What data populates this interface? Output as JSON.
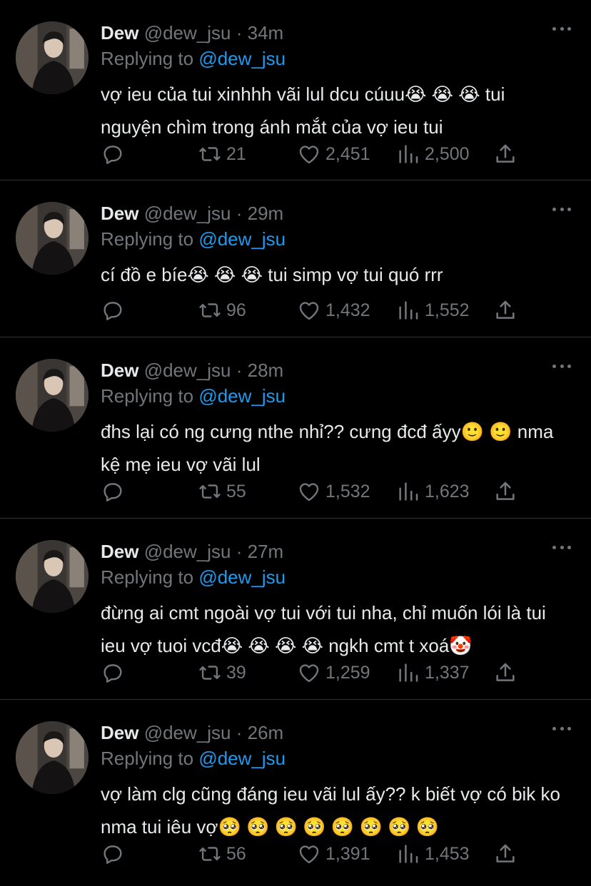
{
  "tweets": [
    {
      "name": "Dew",
      "handle": "@dew_jsu",
      "separator": "·",
      "time": "34m",
      "replying_prefix": "Replying to",
      "replying_to": "@dew_jsu",
      "text": "vợ ieu của tui xinhhh vãi lul dcu cúuu😭 😭 😭 tui nguyện chìm trong ánh mắt của vợ ieu tui",
      "replies": "",
      "retweets": "21",
      "likes": "2,451",
      "views": "2,500"
    },
    {
      "name": "Dew",
      "handle": "@dew_jsu",
      "separator": "·",
      "time": "29m",
      "replying_prefix": "Replying to",
      "replying_to": "@dew_jsu",
      "text": "cí đồ e bíe😭 😭 😭 tui simp vợ tui quó rrr",
      "replies": "",
      "retweets": "96",
      "likes": "1,432",
      "views": "1,552"
    },
    {
      "name": "Dew",
      "handle": "@dew_jsu",
      "separator": "·",
      "time": "28m",
      "replying_prefix": "Replying to",
      "replying_to": "@dew_jsu",
      "text": "đhs lại có ng cưng nthe nhỉ?? cưng đcđ ấyy🙂 🙂 nma kệ mẹ ieu vợ vãi lul",
      "replies": "",
      "retweets": "55",
      "likes": "1,532",
      "views": "1,623"
    },
    {
      "name": "Dew",
      "handle": "@dew_jsu",
      "separator": "·",
      "time": "27m",
      "replying_prefix": "Replying to",
      "replying_to": "@dew_jsu",
      "text": "đừng ai cmt ngoài vợ tui với tui nha, chỉ muốn lói là tui ieu vợ tuoi vcđ😭 😭 😭 😭 ngkh cmt t xoá🤡",
      "replies": "",
      "retweets": "39",
      "likes": "1,259",
      "views": "1,337"
    },
    {
      "name": "Dew",
      "handle": "@dew_jsu",
      "separator": "·",
      "time": "26m",
      "replying_prefix": "Replying to",
      "replying_to": "@dew_jsu",
      "text": "vợ làm clg cũng đáng ieu vãi lul ấy?? k biết vợ có bik ko nma tui iêu vợ🥺 🥺 🥺 🥺 🥺 🥺 🥺 🥺",
      "replies": "",
      "retweets": "56",
      "likes": "1,391",
      "views": "1,453"
    }
  ],
  "icons": {
    "more": "more-dots-icon",
    "reply": "reply-bubble-icon",
    "retweet": "retweet-icon",
    "like": "heart-icon",
    "views": "views-bar-chart-icon",
    "share": "share-upload-icon"
  },
  "colors": {
    "background": "#000000",
    "text": "#e7e9ea",
    "muted": "#71767b",
    "link": "#1d9bf0",
    "divider": "#2f3336"
  }
}
